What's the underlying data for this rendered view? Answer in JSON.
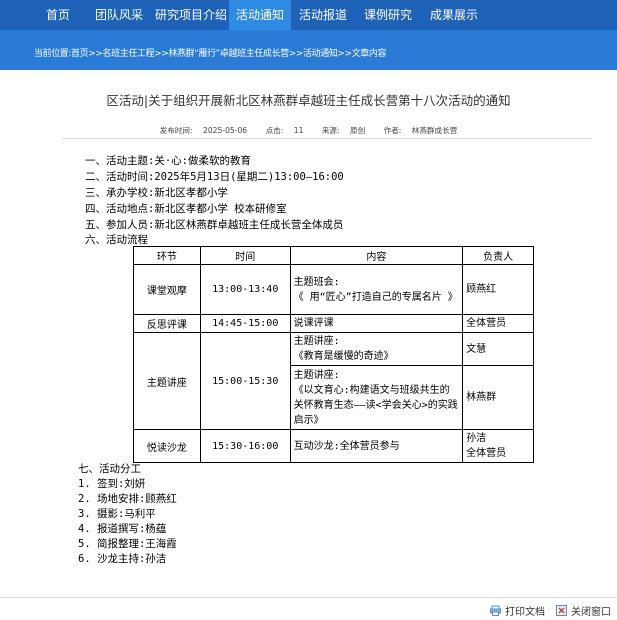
{
  "nav": {
    "items": [
      "首页",
      "团队风采",
      "研究项目介绍",
      "活动通知",
      "活动报道",
      "课例研究",
      "成果展示"
    ],
    "active_index": 3
  },
  "breadcrumb": {
    "label": "当前位置:",
    "path": "首页>>名班主任工程>>林燕群“雁行”卓越班主任成长营>>活动通知>>文章内容"
  },
  "article": {
    "title": "区活动|关于组织开展新北区林燕群卓越班主任成长营第十八次活动的通知",
    "meta": {
      "publish_label": "发布时间:",
      "publish_date": "2025-05-06",
      "clicks_label": "点击:",
      "clicks": "11",
      "source_label": "来源:",
      "source": "原创",
      "author_label": "作者:",
      "author": "林燕群成长营"
    },
    "sections": [
      "一、活动主题:关·心:做柔软的教育",
      "二、活动时间:2025年5月13日(星期二)13:00—16:00",
      "三、承办学校:新北区孝都小学",
      "四、活动地点:新北区孝都小学 校本研修室",
      "五、参加人员:新北区林燕群卓越班主任成长营全体成员",
      "六、活动流程"
    ],
    "table": {
      "headers": [
        "环节",
        "时间",
        "内容",
        "负责人"
      ],
      "rows": {
        "r1": {
          "stage": "课堂观摩",
          "time": "13:00-13:40",
          "content_a": "主题班会:",
          "content_b": "《 用“匠心”打造自己的专属名片 》",
          "owner": "顾燕红"
        },
        "r2": {
          "stage": "反思评课",
          "time": "14:45-15:00",
          "content": "说课评课",
          "owner": "全体营员"
        },
        "r3": {
          "stage": "主题讲座",
          "time": "15:00-15:30",
          "content_a1": "主题讲座:",
          "content_a2": "《教育是缓慢的奇迹》",
          "owner_a": "文慧",
          "content_b1": "主题讲座:",
          "content_b2": "《以文育心:构建语文与班级共生的关怀教育生态——读<学会关心>的实践启示》",
          "owner_b": "林燕群"
        },
        "r4": {
          "stage": "悦读沙龙",
          "time": "15:30-16:00",
          "content": "互动沙龙:全体营员参与",
          "owner_a": "孙洁",
          "owner_b": "全体营员"
        }
      }
    },
    "division": {
      "heading": "七、活动分工",
      "items": [
        "1. 签到:刘妍",
        "2. 场地安排:顾燕红",
        "3. 摄影:马利平",
        "4. 报道撰写:杨蕴",
        "5. 简报整理:王海霞",
        "6. 沙龙主持:孙洁"
      ]
    }
  },
  "footer": {
    "print_label": "打印文档",
    "close_label": "关闭窗口"
  }
}
